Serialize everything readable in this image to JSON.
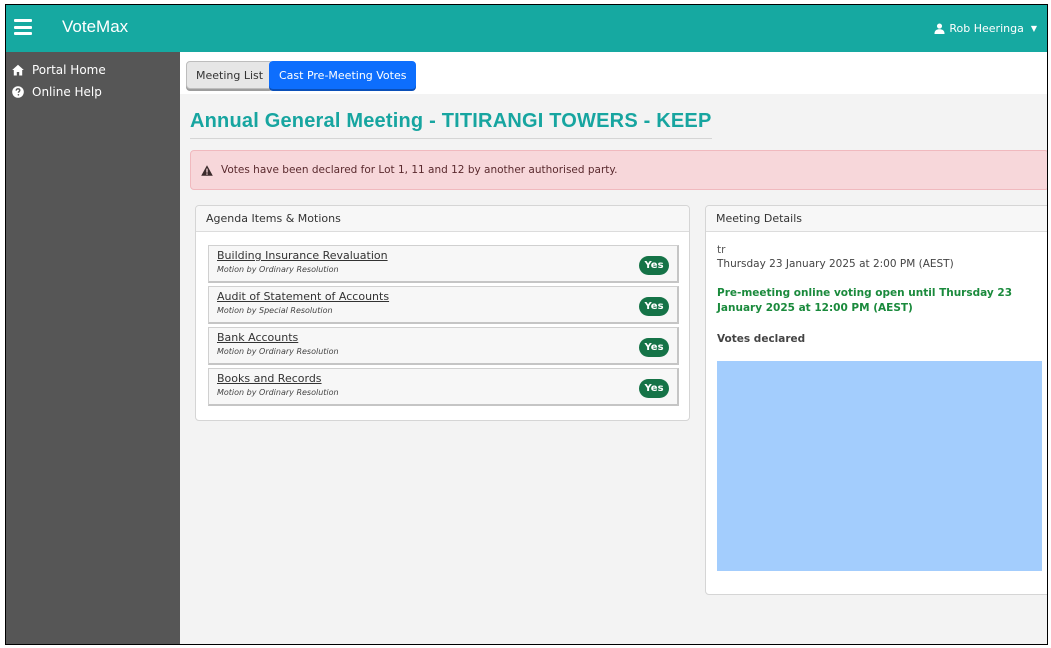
{
  "app": {
    "title": "VoteMax"
  },
  "user": {
    "name": "Rob Heeringa"
  },
  "sidebar": {
    "items": [
      {
        "label": "Portal Home",
        "icon": "home-icon"
      },
      {
        "label": "Online Help",
        "icon": "help-icon"
      }
    ]
  },
  "tabs": [
    {
      "label": "Meeting List",
      "active": false
    },
    {
      "label": "Cast Pre-Meeting Votes",
      "active": true
    }
  ],
  "page": {
    "title": "Annual General Meeting - TITIRANGI TOWERS - KEEP"
  },
  "alert": {
    "text": "Votes have been declared for Lot 1, 11 and 12 by another authorised party."
  },
  "agenda": {
    "header": "Agenda Items & Motions",
    "motions": [
      {
        "title": "Building Insurance Revaluation",
        "type": "Motion by Ordinary Resolution",
        "vote": "Yes"
      },
      {
        "title": "Audit of Statement of Accounts",
        "type": "Motion by Special Resolution",
        "vote": "Yes"
      },
      {
        "title": "Bank Accounts",
        "type": "Motion by Ordinary Resolution",
        "vote": "Yes"
      },
      {
        "title": "Books and Records",
        "type": "Motion by Ordinary Resolution",
        "vote": "Yes"
      }
    ]
  },
  "meeting": {
    "header": "Meeting Details",
    "name": "tr",
    "date": "Thursday 23 January 2025 at 2:00 PM (AEST)",
    "prevote_status": "Pre-meeting online voting open until Thursday 23 January 2025 at 12:00 PM (AEST)",
    "votes_declared_label": "Votes declared"
  },
  "colors": {
    "topbar": "#16a9a1",
    "sidebar": "#565656",
    "accent": "#17a5a0",
    "primary_button": "#0d6efd",
    "yes_badge": "#157347",
    "alert_bg": "#f7d7da",
    "votes_box": "#a3cdfd"
  }
}
